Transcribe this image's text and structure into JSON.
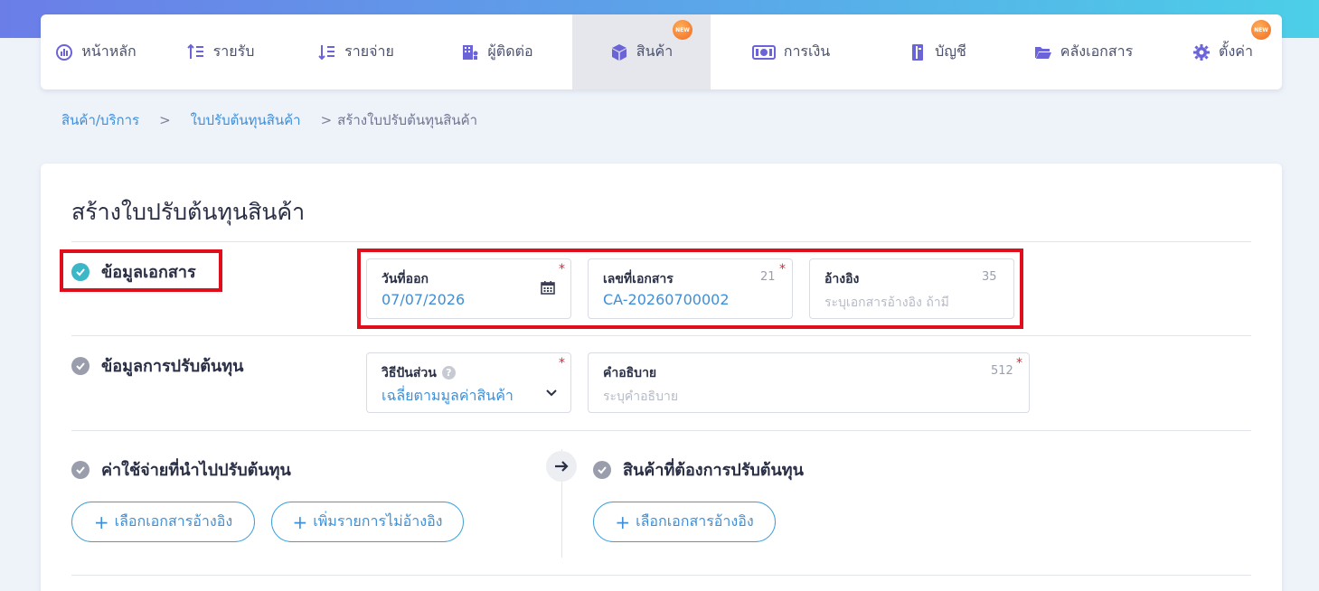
{
  "nav": {
    "items": [
      {
        "label": "หน้าหลัก",
        "icon": "dashboard-gauge-icon",
        "active": false
      },
      {
        "label": "รายรับ",
        "icon": "income-sort-icon",
        "active": false
      },
      {
        "label": "รายจ่าย",
        "icon": "expense-sort-icon",
        "active": false
      },
      {
        "label": "ผู้ติดต่อ",
        "icon": "contacts-building-icon",
        "active": false
      },
      {
        "label": "สินค้า",
        "icon": "product-box-icon",
        "active": true,
        "badge": "NEW"
      },
      {
        "label": "การเงิน",
        "icon": "money-bill-icon",
        "active": false
      },
      {
        "label": "บัญชี",
        "icon": "account-book-icon",
        "active": false
      },
      {
        "label": "คลังเอกสาร",
        "icon": "folder-open-icon",
        "active": false
      },
      {
        "label": "ตั้งค่า",
        "icon": "gear-icon",
        "active": false,
        "badge": "NEW"
      }
    ]
  },
  "breadcrumb": {
    "items": [
      "สินค้า/บริการ",
      "ใบปรับต้นทุนสินค้า",
      "สร้างใบปรับต้นทุนสินค้า"
    ],
    "separator": ">"
  },
  "page": {
    "title": "สร้างใบปรับต้นทุนสินค้า"
  },
  "sections": {
    "document_info": {
      "title": "ข้อมูลเอกสาร",
      "issue_date": {
        "label": "วันที่ออก",
        "value": "07/07/2026",
        "required": "*"
      },
      "doc_number": {
        "label": "เลขที่เอกสาร",
        "value": "CA-20260700002",
        "counter": "21",
        "required": "*"
      },
      "reference": {
        "label": "อ้างอิง",
        "placeholder": "ระบุเอกสารอ้างอิง ถ้ามี",
        "counter": "35"
      }
    },
    "adjust_info": {
      "title": "ข้อมูลการปรับต้นทุน",
      "method": {
        "label": "วิธีปันส่วน",
        "help": "?",
        "value": "เฉลี่ยตามมูลค่าสินค้า",
        "required": "*"
      },
      "description": {
        "label": "คำอธิบาย",
        "placeholder": "ระบุคำอธิบาย",
        "counter": "512",
        "required": "*"
      }
    },
    "expenses": {
      "title": "ค่าใช้จ่ายที่นำไปปรับต้นทุน",
      "select_ref_button": "เลือกเอกสารอ้างอิง",
      "add_item_button": "เพิ่มรายการไม่อ้างอิง"
    },
    "products": {
      "title": "สินค้าที่ต้องการปรับต้นทุน",
      "select_ref_button": "เลือกเอกสารอ้างอิง"
    }
  },
  "buttons": {
    "plus": "+"
  },
  "colors": {
    "accent": "#3f8fd8",
    "check_done": "#3bb7c8",
    "check_todo": "#9a9dab",
    "highlight": "#e00d1a",
    "badge": "#f26a21"
  }
}
